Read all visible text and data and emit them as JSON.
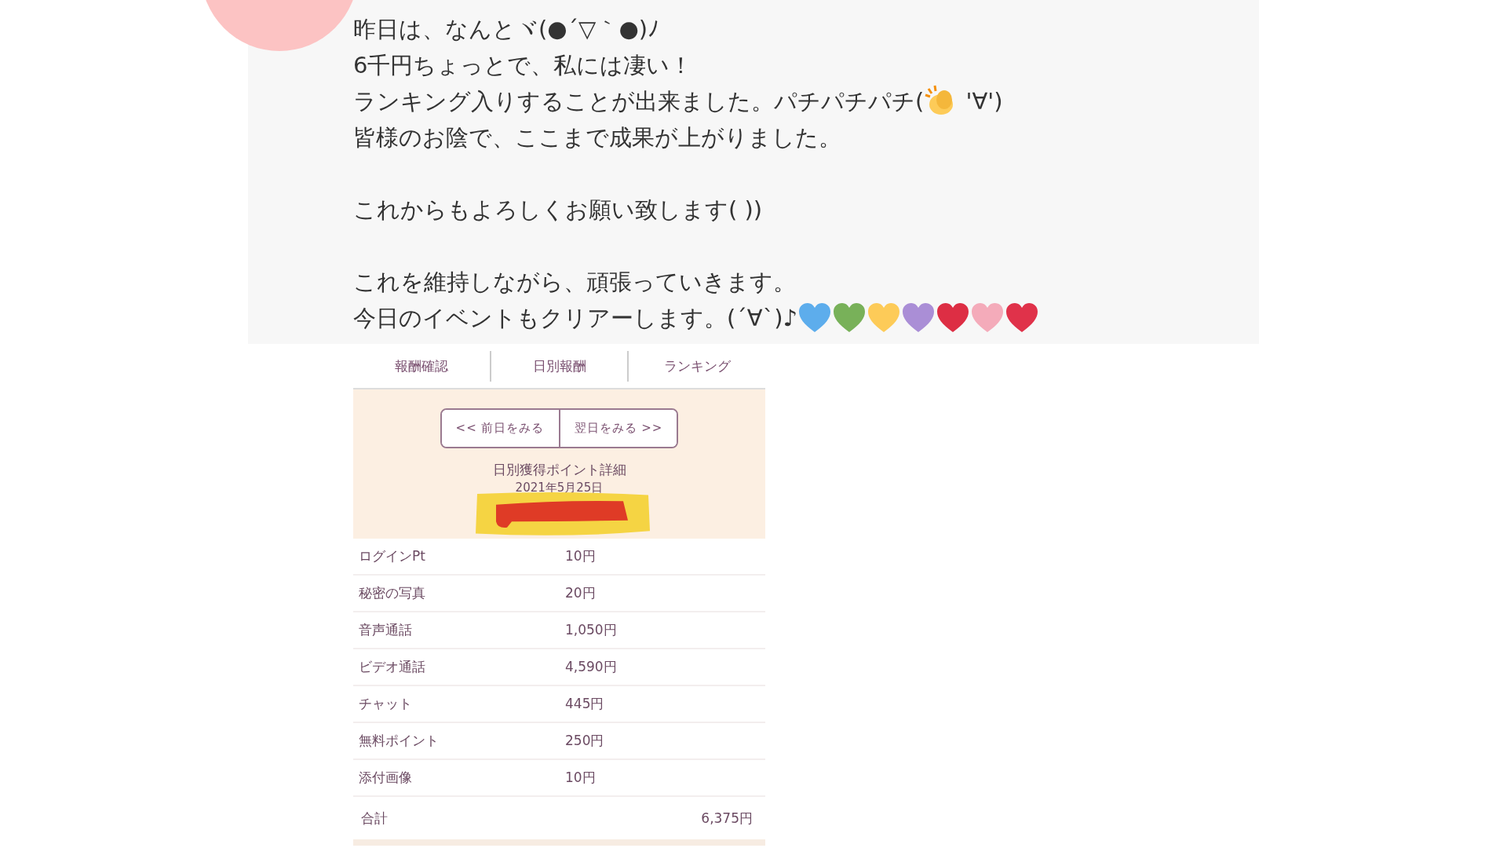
{
  "post": {
    "paragraphs": [
      [
        {
          "text": "昨日は、なんとヾ(●´▽｀●)ﾉ"
        },
        {
          "text": "6千円ちょっとで、私には凄い！"
        },
        {
          "text": "ランキング入りすることが出来ました。パチパチパチ(",
          "kind": "clap",
          "after": " '∀')"
        },
        {
          "text": "皆様のお陰で、ここまで成果が上がりました。"
        }
      ],
      [
        {
          "text": "これからもよろしくお願い致します( ))"
        }
      ],
      [
        {
          "text": "これを維持しながら、頑張っていきます。"
        },
        {
          "text": "今日のイベントもクリアーします。(´∀`)♪",
          "kind": "hearts",
          "hearts": [
            {
              "color": "#5dadec"
            },
            {
              "color": "#78b159"
            },
            {
              "color": "#fdcb58"
            },
            {
              "color": "#aa8ed6"
            },
            {
              "color": "#dd2e44"
            },
            {
              "color": "#f4abba"
            },
            {
              "color": "#e0324a"
            }
          ]
        }
      ]
    ]
  },
  "screenshot": {
    "tabs": [
      {
        "label": "報酬確認"
      },
      {
        "label": "日別報酬"
      },
      {
        "label": "ランキング"
      }
    ],
    "nav_buttons": [
      "<< 前日をみる",
      "翌日をみる >>"
    ],
    "title": "日別獲得ポイント詳細",
    "date": "2021年5月25日",
    "rows": [
      {
        "label": "ログインPt",
        "value": "10円"
      },
      {
        "label": "秘密の写真",
        "value": "20円"
      },
      {
        "label": "音声通話",
        "value": "1,050円"
      },
      {
        "label": "ビデオ通話",
        "value": "4,590円"
      },
      {
        "label": "チャット",
        "value": "445円"
      },
      {
        "label": "無料ポイント",
        "value": "250円"
      },
      {
        "label": "添付画像",
        "value": "10円"
      }
    ],
    "total": {
      "label": "合計",
      "value": "6,375円"
    }
  }
}
